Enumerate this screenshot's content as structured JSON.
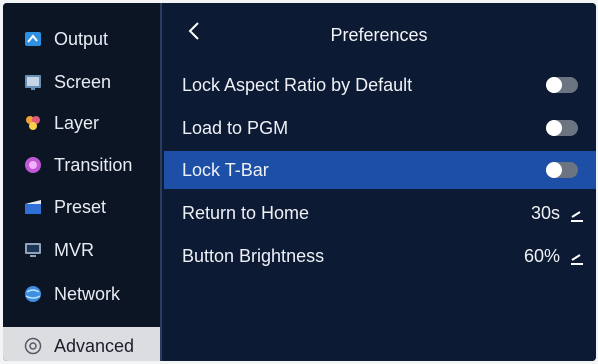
{
  "sidebar": {
    "items": [
      {
        "label": "Output",
        "icon": "output-icon"
      },
      {
        "label": "Screen",
        "icon": "screen-icon"
      },
      {
        "label": "Layer",
        "icon": "layer-icon"
      },
      {
        "label": "Transition",
        "icon": "transition-icon"
      },
      {
        "label": "Preset",
        "icon": "preset-icon"
      },
      {
        "label": "MVR",
        "icon": "mvr-icon"
      },
      {
        "label": "Network",
        "icon": "network-icon"
      },
      {
        "label": "Advanced",
        "icon": "gear-icon"
      }
    ],
    "selected": "Advanced"
  },
  "header": {
    "title": "Preferences",
    "back_icon": "chevron-left-icon"
  },
  "settings": [
    {
      "label": "Lock Aspect Ratio by Default",
      "type": "toggle",
      "state": "off"
    },
    {
      "label": "Load to PGM",
      "type": "toggle",
      "state": "off"
    },
    {
      "label": "Lock T-Bar",
      "type": "toggle",
      "state": "off",
      "highlighted": true
    },
    {
      "label": "Return to Home",
      "type": "value",
      "value": "30s",
      "icon": "edit-icon"
    },
    {
      "label": "Button Brightness",
      "type": "value",
      "value": "60%",
      "icon": "edit-icon"
    }
  ],
  "colors": {
    "background": "#0d1a33",
    "sidebar": "#0c1524",
    "highlight": "#1d4fa6",
    "selected_sidebar": "#dcdde0",
    "toggle_off": "#6c7481"
  }
}
